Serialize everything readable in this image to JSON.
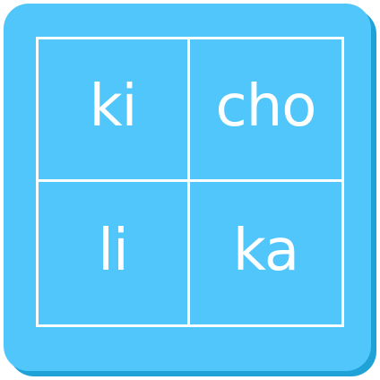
{
  "colors": {
    "card": "#51c6fb",
    "card_shadow": "#1fa2d8",
    "text": "#ffffff",
    "grid_lines": "#ffffff"
  },
  "grid": {
    "cells": [
      {
        "label": "ki"
      },
      {
        "label": "cho"
      },
      {
        "label": "li"
      },
      {
        "label": "ka"
      }
    ]
  }
}
